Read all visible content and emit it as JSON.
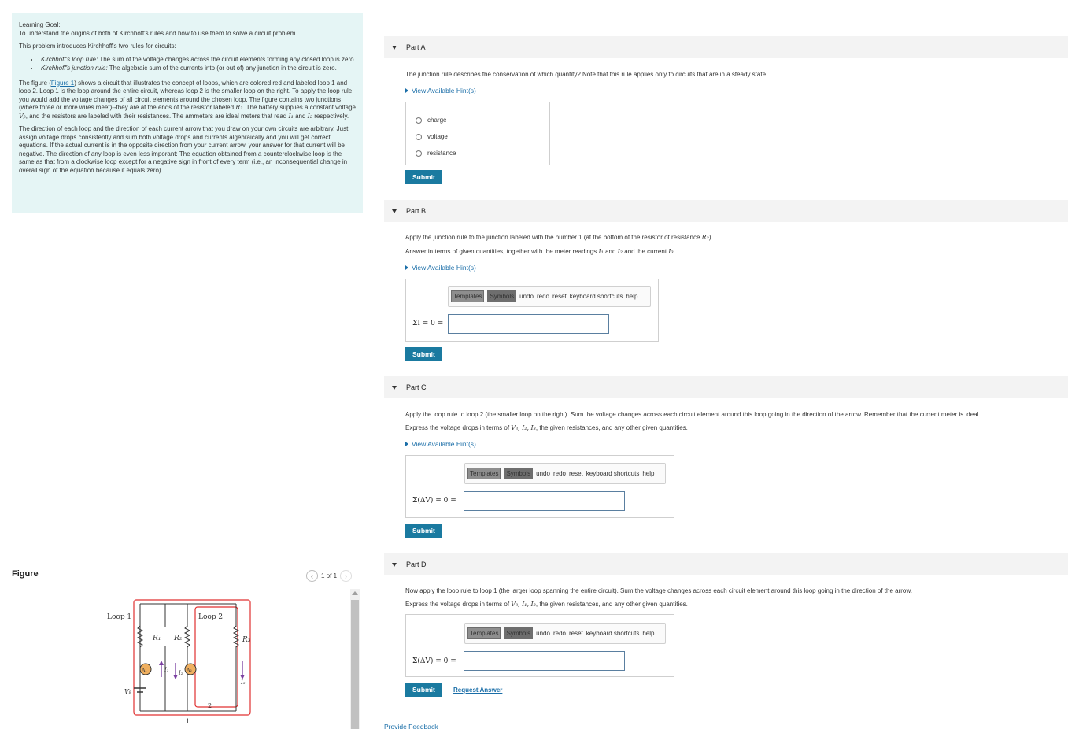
{
  "learning_goal": {
    "title": "Learning Goal:",
    "subtitle": "To understand the origins of both of Kirchhoff's rules and how to use them to solve a circuit problem.",
    "intro": "This problem introduces Kirchhoff's two rules for circuits:",
    "rules": [
      {
        "name": "Kirchhoff's loop rule:",
        "text": " The sum of the voltage changes across the circuit elements forming any closed loop is zero."
      },
      {
        "name": "Kirchhoff's junction rule:",
        "text": " The algebraic sum of the currents into (or out of) any junction in the circuit is zero."
      }
    ],
    "para1_a": "The figure (",
    "para1_link": "Figure 1",
    "para1_b": ") shows a circuit that illustrates the concept of loops, which are colored red and labeled loop 1 and loop 2. Loop 1 is the loop around the entire circuit, whereas loop 2 is the smaller loop on the right. To apply the loop rule you would add the voltage changes of all circuit elements around the chosen loop. The figure contains two junctions (where three or more wires meet)--they are at the ends of the resistor labeled ",
    "para1_r3": "R₃",
    "para1_c": ". The battery supplies a constant voltage ",
    "para1_vb": "Vᵦ",
    "para1_d": ", and the resistors are labeled with their resistances. The ammeters are ideal meters that read ",
    "para1_i1": "I₁",
    "para1_e": " and ",
    "para1_i2": "I₂",
    "para1_f": " respectively.",
    "para2": "The direction of each loop and the direction of each current arrow that you draw on your own circuits are arbitrary. Just assign voltage drops consistently and sum both voltage drops and currents algebraically and you will get correct equations. If the actual current is in the opposite direction from your current arrow, your answer for that current will be negative. The direction of any loop is even less imporant: The equation obtained from a counterclockwise loop is the same as that from a clockwise loop except for a negative sign in front of every term (i.e., an inconsequential change in overall sign of the equation because it equals zero)."
  },
  "figure": {
    "title": "Figure",
    "pager": "1 of 1",
    "labels": {
      "loop1": "Loop 1",
      "loop2": "Loop 2",
      "r1": "R₁",
      "r2": "R₂",
      "r3": "R₃",
      "a1": "A₁",
      "a2": "A₂",
      "i1": "I₁",
      "i2": "I₂",
      "i3": "I₃",
      "vb": "Vᵦ",
      "j1": "1",
      "j2": "2"
    },
    "colors": {
      "loop": "#e03030",
      "wire": "#333333",
      "ammeter": "#f0b060",
      "arrow": "#7a3fa0"
    }
  },
  "toolbar": {
    "templates": "Templates",
    "symbols": "Symbols",
    "undo": "undo",
    "redo": "redo",
    "reset": "reset",
    "shortcuts": "keyboard shortcuts",
    "help": "help"
  },
  "submit_label": "Submit",
  "hint_label": "View Available Hint(s)",
  "parts": {
    "a": {
      "title": "Part A",
      "question": "The junction rule describes the conservation of which quantity? Note that this rule applies only to circuits that are in a steady state.",
      "options": [
        "charge",
        "voltage",
        "resistance"
      ]
    },
    "b": {
      "title": "Part B",
      "question_a": "Apply the junction rule to the junction labeled with the number 1 (at the bottom of the resistor of resistance ",
      "question_r": "R₂",
      "question_b": ").",
      "instr_a": "Answer in terms of given quantities, together with the meter readings ",
      "instr_i1": "I₁",
      "instr_and": " and ",
      "instr_i2": "I₂",
      "instr_b": " and the current ",
      "instr_i3": "I₃",
      "instr_c": ".",
      "eq": "ΣI = 0 ="
    },
    "c": {
      "title": "Part C",
      "question": "Apply the loop rule to loop 2 (the smaller loop on the right). Sum the voltage changes across each circuit element around this loop going in the direction of the arrow. Remember that the current meter is ideal.",
      "instr_a": "Express the voltage drops in terms of ",
      "instr_vars": "Vᵦ, I₂, I₃",
      "instr_b": ", the given resistances, and any other given quantities.",
      "eq": "Σ(ΔV) = 0 ="
    },
    "d": {
      "title": "Part D",
      "question": "Now apply the loop rule to loop 1 (the larger loop spanning the entire circuit). Sum the voltage changes across each circuit element around this loop going in the direction of the arrow.",
      "instr_a": "Express the voltage drops in terms of ",
      "instr_vars": "Vᵦ, I₁, I₃",
      "instr_b": ", the given resistances, and any other given quantities.",
      "eq": "Σ(ΔV) = 0 =",
      "request": "Request Answer"
    }
  },
  "feedback": "Provide Feedback"
}
